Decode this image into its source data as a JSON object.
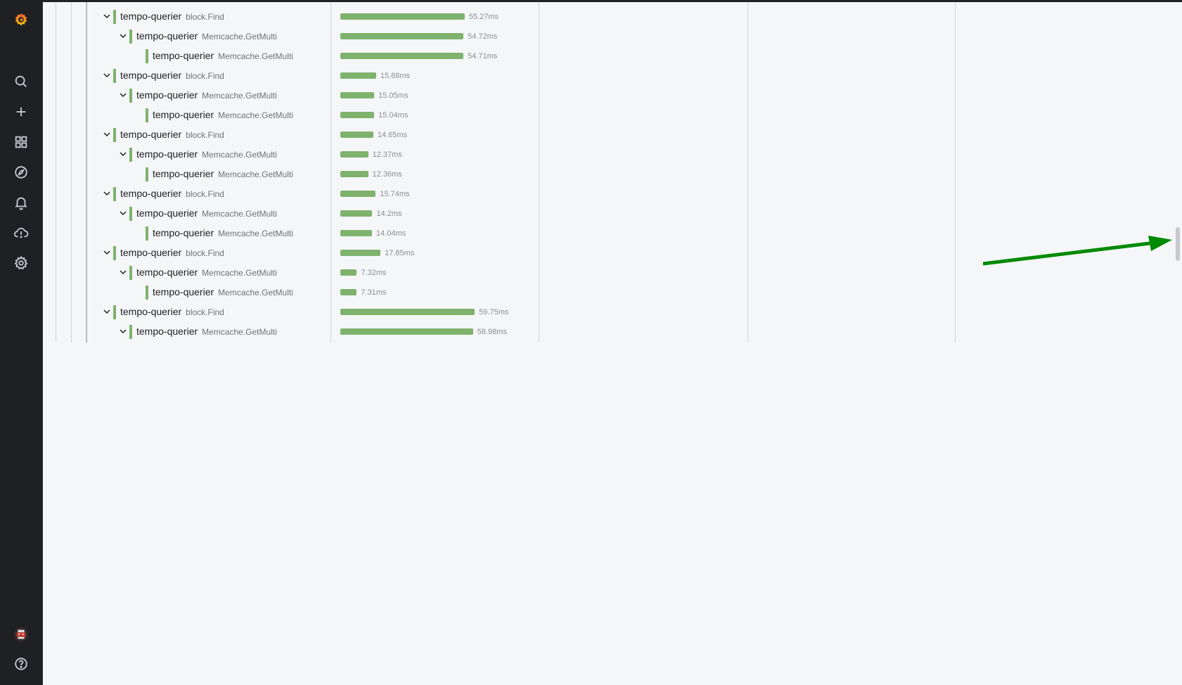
{
  "sidebar": {
    "logo": "grafana-logo",
    "items": [
      {
        "name": "search-icon"
      },
      {
        "name": "plus-icon"
      },
      {
        "name": "dashboards-icon"
      },
      {
        "name": "explore-compass-icon"
      },
      {
        "name": "alerting-bell-icon"
      },
      {
        "name": "cloud-alert-icon"
      },
      {
        "name": "gear-icon"
      }
    ],
    "bottom": [
      {
        "name": "avatar"
      },
      {
        "name": "help-icon"
      }
    ]
  },
  "colors": {
    "span": "#7eb26d",
    "annotation_arrow": "#008a00"
  },
  "spans": [
    {
      "depth": 0,
      "expandable": true,
      "service": "tempo-querier",
      "operation": "block.Find",
      "duration": "55.27ms",
      "duration_ms": 55.27
    },
    {
      "depth": 1,
      "expandable": true,
      "service": "tempo-querier",
      "operation": "Memcache.GetMulti",
      "duration": "54.72ms",
      "duration_ms": 54.72
    },
    {
      "depth": 2,
      "expandable": false,
      "service": "tempo-querier",
      "operation": "Memcache.GetMulti",
      "duration": "54.71ms",
      "duration_ms": 54.71
    },
    {
      "depth": 0,
      "expandable": true,
      "service": "tempo-querier",
      "operation": "block.Find",
      "duration": "15.88ms",
      "duration_ms": 15.88
    },
    {
      "depth": 1,
      "expandable": true,
      "service": "tempo-querier",
      "operation": "Memcache.GetMulti",
      "duration": "15.05ms",
      "duration_ms": 15.05
    },
    {
      "depth": 2,
      "expandable": false,
      "service": "tempo-querier",
      "operation": "Memcache.GetMulti",
      "duration": "15.04ms",
      "duration_ms": 15.04
    },
    {
      "depth": 0,
      "expandable": true,
      "service": "tempo-querier",
      "operation": "block.Find",
      "duration": "14.65ms",
      "duration_ms": 14.65
    },
    {
      "depth": 1,
      "expandable": true,
      "service": "tempo-querier",
      "operation": "Memcache.GetMulti",
      "duration": "12.37ms",
      "duration_ms": 12.37
    },
    {
      "depth": 2,
      "expandable": false,
      "service": "tempo-querier",
      "operation": "Memcache.GetMulti",
      "duration": "12.36ms",
      "duration_ms": 12.36
    },
    {
      "depth": 0,
      "expandable": true,
      "service": "tempo-querier",
      "operation": "block.Find",
      "duration": "15.74ms",
      "duration_ms": 15.74
    },
    {
      "depth": 1,
      "expandable": true,
      "service": "tempo-querier",
      "operation": "Memcache.GetMulti",
      "duration": "14.2ms",
      "duration_ms": 14.2
    },
    {
      "depth": 2,
      "expandable": false,
      "service": "tempo-querier",
      "operation": "Memcache.GetMulti",
      "duration": "14.04ms",
      "duration_ms": 14.04
    },
    {
      "depth": 0,
      "expandable": true,
      "service": "tempo-querier",
      "operation": "block.Find",
      "duration": "17.85ms",
      "duration_ms": 17.85
    },
    {
      "depth": 1,
      "expandable": true,
      "service": "tempo-querier",
      "operation": "Memcache.GetMulti",
      "duration": "7.32ms",
      "duration_ms": 7.32
    },
    {
      "depth": 2,
      "expandable": false,
      "service": "tempo-querier",
      "operation": "Memcache.GetMulti",
      "duration": "7.31ms",
      "duration_ms": 7.31
    },
    {
      "depth": 0,
      "expandable": true,
      "service": "tempo-querier",
      "operation": "block.Find",
      "duration": "59.75ms",
      "duration_ms": 59.75
    },
    {
      "depth": 1,
      "expandable": true,
      "service": "tempo-querier",
      "operation": "Memcache.GetMulti",
      "duration": "58.98ms",
      "duration_ms": 58.98
    }
  ]
}
